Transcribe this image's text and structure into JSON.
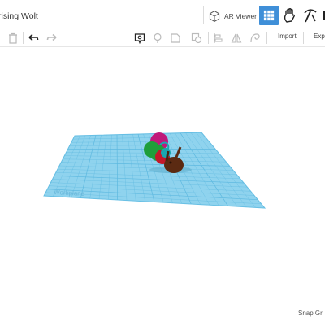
{
  "header": {
    "project_title": "rising Wolt",
    "ar_viewer_label": "AR Viewer"
  },
  "toolbar": {
    "import_label": "Import",
    "export_label": "Expo"
  },
  "workspace": {
    "workplane_label": "Workplane",
    "snap_grid_label": "Snap Gri"
  },
  "colors": {
    "accent": "#3f8fd8",
    "workplane": "#8fd3ee",
    "grid_line": "#5eb9e0",
    "caterpillar_brown": "#5b2a12",
    "caterpillar_magenta": "#c0197a",
    "caterpillar_green": "#1f9e3a",
    "caterpillar_red": "#c3182a",
    "caterpillar_teal": "#1aa7b0"
  },
  "icons": [
    "ar-viewer-icon",
    "grid-view-icon",
    "hand-icon",
    "pickaxe-icon",
    "trash-icon",
    "undo-icon",
    "redo-icon",
    "note-icon",
    "light-icon",
    "shape-icon",
    "group-icon",
    "align-icon",
    "mirror-icon",
    "workplane-icon"
  ]
}
